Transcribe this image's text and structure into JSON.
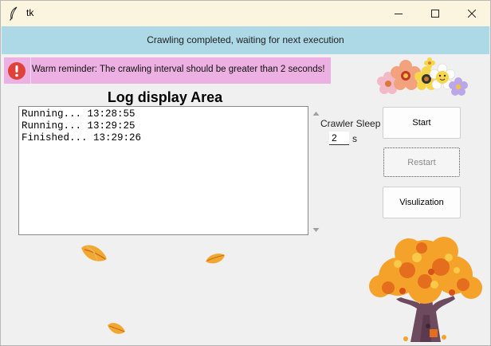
{
  "window": {
    "title": "tk",
    "controls": {
      "minimize_icon": "minimize-icon",
      "maximize_icon": "maximize-icon",
      "close_icon": "close-icon"
    }
  },
  "status": {
    "text": "Crawling completed, waiting for next execution",
    "background": "#add8e6"
  },
  "reminder": {
    "icon": "warning-icon",
    "text": "Warm reminder: The crawling interval should be greater than 2 seconds!",
    "background": "#ecb0e2",
    "icon_color": "#e0413a"
  },
  "log": {
    "title": "Log display Area",
    "lines": [
      "Running... 13:28:55",
      "Running... 13:29:25",
      "Finished... 13:29:26"
    ]
  },
  "sleep": {
    "label": "Crawler Sleep",
    "value": "2",
    "unit": "s"
  },
  "buttons": {
    "start": "Start",
    "restart": "Restart",
    "visualization": "Visulization"
  },
  "decorations": {
    "flowers": "flowers-image",
    "tree": "autumn-tree-image",
    "leaves": "falling-leaf-image"
  }
}
